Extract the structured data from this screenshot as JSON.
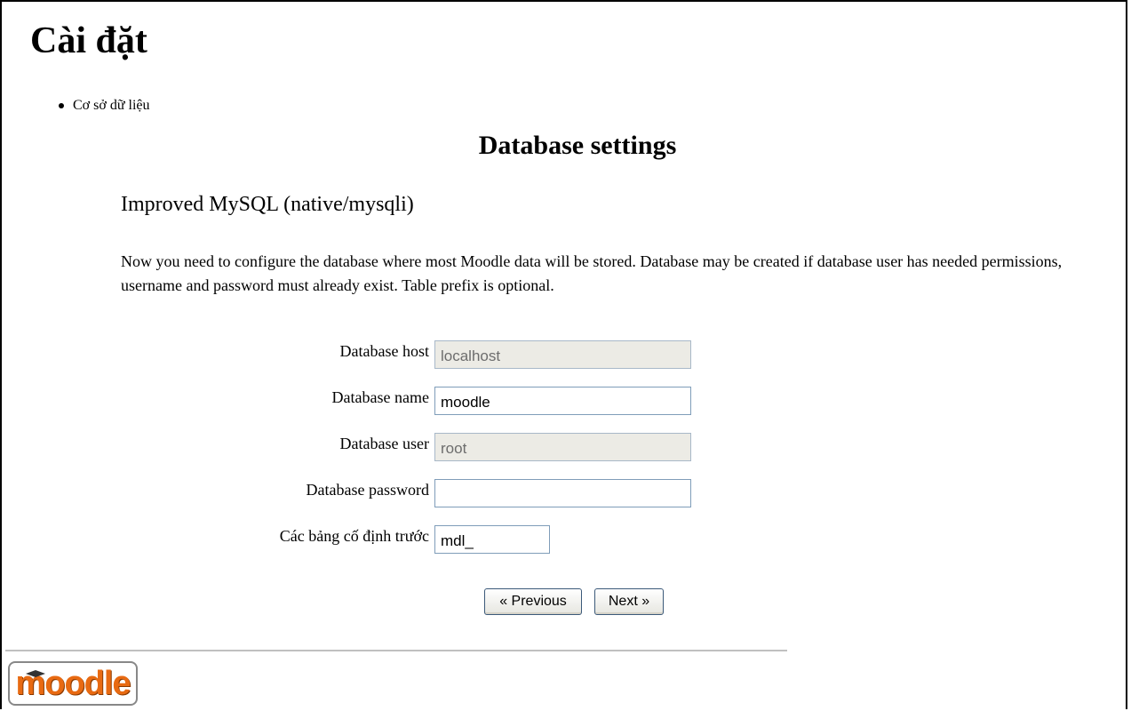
{
  "page": {
    "title": "Cài đặt"
  },
  "breadcrumb": {
    "items": [
      "Cơ sở dữ liệu"
    ]
  },
  "section": {
    "heading": "Database settings",
    "driver_heading": "Improved MySQL (native/mysqli)",
    "intro": "Now you need to configure the database where most Moodle data will be stored. Database may be created if database user has needed permissions, username and password must already exist. Table prefix is optional."
  },
  "form": {
    "dbhost": {
      "label": "Database host",
      "value": "localhost",
      "readonly": true
    },
    "dbname": {
      "label": "Database name",
      "value": "moodle",
      "readonly": false
    },
    "dbuser": {
      "label": "Database user",
      "value": "root",
      "readonly": true
    },
    "dbpass": {
      "label": "Database password",
      "value": "",
      "readonly": false
    },
    "prefix": {
      "label": "Các bảng cố định trước",
      "value": "mdl_",
      "readonly": false
    }
  },
  "buttons": {
    "previous": "« Previous",
    "next": "Next »"
  },
  "footer": {
    "logo_text": "moodle"
  },
  "colors": {
    "logo_orange": "#e86a12",
    "readonly_field_bg": "#ecebe5",
    "input_border": "#7f9db9"
  }
}
